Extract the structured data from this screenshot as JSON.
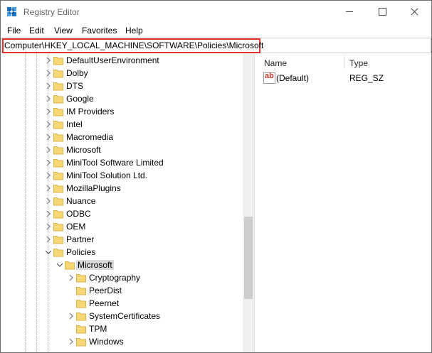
{
  "window": {
    "title": "Registry Editor"
  },
  "menu": {
    "items": [
      "File",
      "Edit",
      "View",
      "Favorites",
      "Help"
    ]
  },
  "address": {
    "path": "Computer\\HKEY_LOCAL_MACHINE\\SOFTWARE\\Policies\\Microsoft"
  },
  "tree": {
    "items": [
      {
        "label": "DefaultUserEnvironment",
        "expanded": false
      },
      {
        "label": "Dolby",
        "expanded": false
      },
      {
        "label": "DTS",
        "expanded": false
      },
      {
        "label": "Google",
        "expanded": false
      },
      {
        "label": "IM Providers",
        "expanded": false
      },
      {
        "label": "Intel",
        "expanded": false
      },
      {
        "label": "Macromedia",
        "expanded": false
      },
      {
        "label": "Microsoft",
        "expanded": false
      },
      {
        "label": "MiniTool Software Limited",
        "expanded": false
      },
      {
        "label": "MiniTool Solution Ltd.",
        "expanded": false
      },
      {
        "label": "MozillaPlugins",
        "expanded": false
      },
      {
        "label": "Nuance",
        "expanded": false
      },
      {
        "label": "ODBC",
        "expanded": false
      },
      {
        "label": "OEM",
        "expanded": false
      },
      {
        "label": "Partner",
        "expanded": false
      },
      {
        "label": "Policies",
        "expanded": true
      },
      {
        "label": "Microsoft",
        "expanded": true,
        "selected": true
      },
      {
        "label": "Cryptography",
        "expanded": false
      },
      {
        "label": "PeerDist",
        "expanded": false
      },
      {
        "label": "Peernet",
        "expanded": false
      },
      {
        "label": "SystemCertificates",
        "expanded": false
      },
      {
        "label": "TPM",
        "expanded": false
      },
      {
        "label": "Windows",
        "expanded": false
      }
    ]
  },
  "values_pane": {
    "columns": {
      "name": "Name",
      "type": "Type"
    },
    "rows": [
      {
        "name": "(Default)",
        "type": "REG_SZ",
        "icon": "string-value-icon"
      }
    ]
  },
  "colors": {
    "highlight_border": "#e3332f",
    "folder": "#f8d775",
    "selected_bg": "#d9d9d9"
  }
}
